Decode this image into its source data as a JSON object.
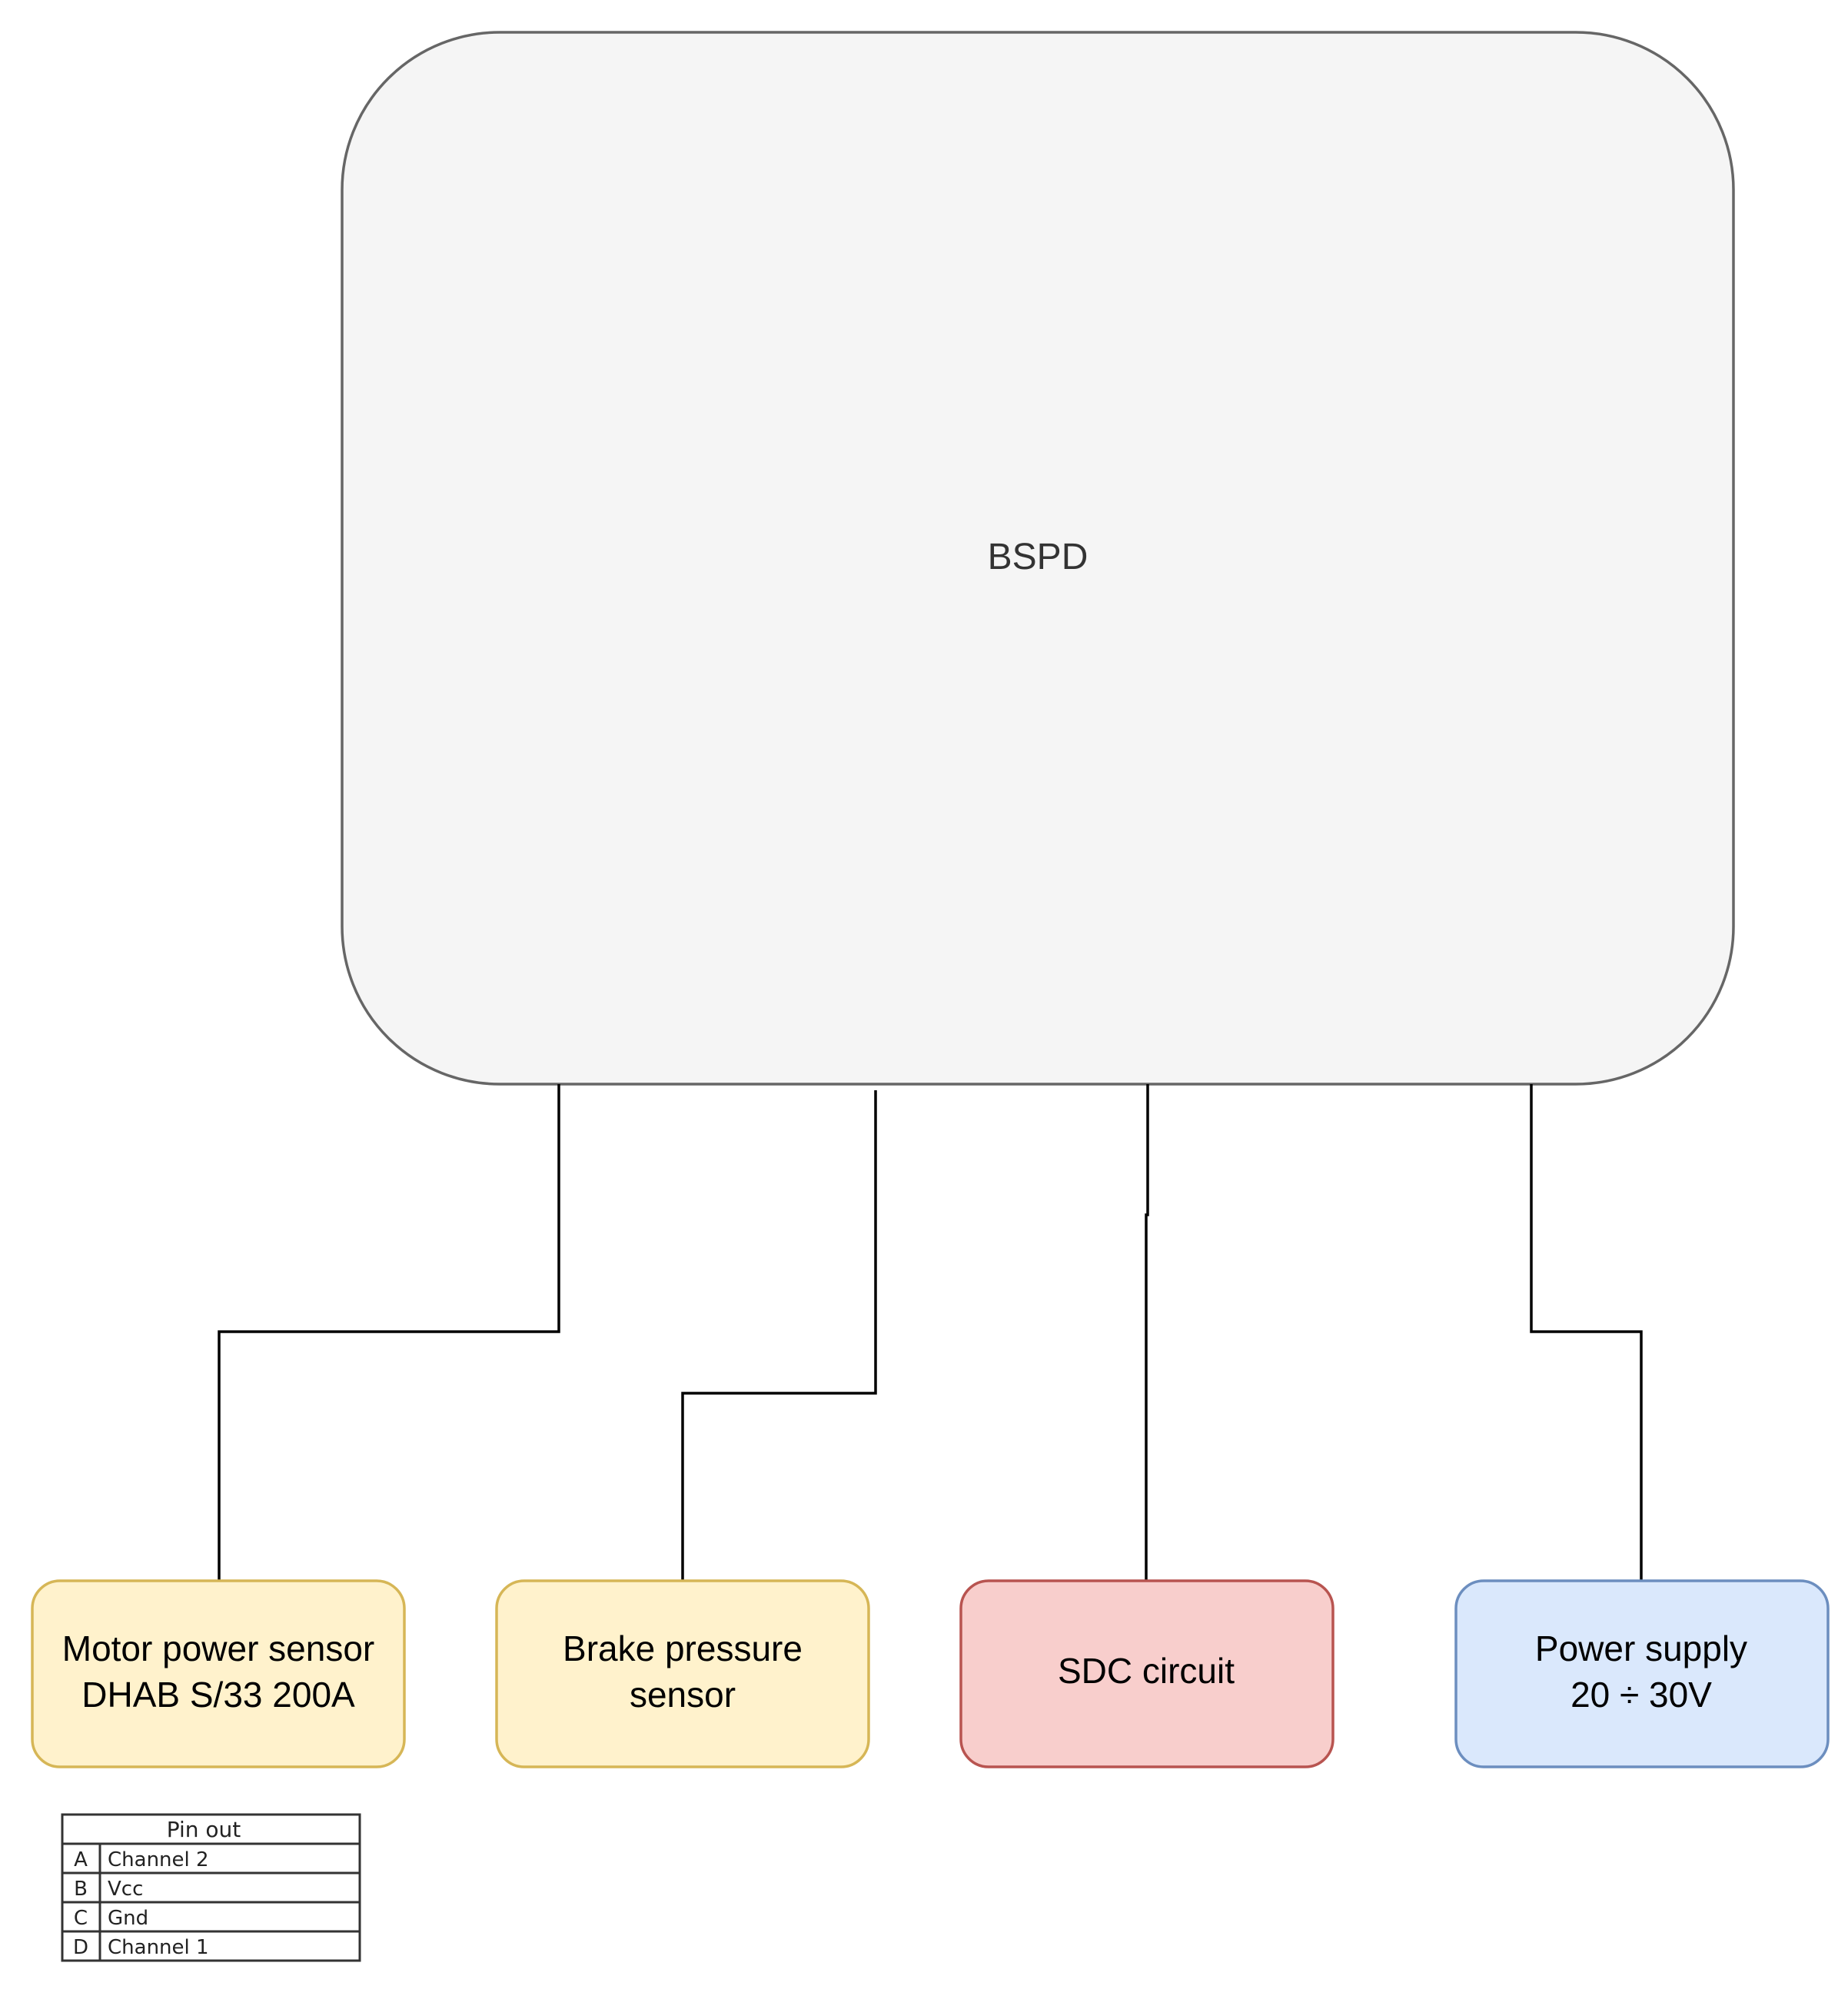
{
  "bspd": {
    "label": "BSPD",
    "fill": "#f5f5f5",
    "stroke": "#666666"
  },
  "nodes": {
    "motor_sensor": {
      "line1": "Motor power sensor",
      "line2": "DHAB S/33 200A",
      "fill": "#fff2cc",
      "stroke": "#d6b656"
    },
    "brake_sensor": {
      "line1": "Brake pressure",
      "line2": "sensor",
      "fill": "#fff2cc",
      "stroke": "#d6b656"
    },
    "sdc": {
      "line1": "SDC circuit",
      "fill": "#f8cecc",
      "stroke": "#b85450"
    },
    "power_supply": {
      "line1": "Power supply",
      "line2": "20 ÷ 30V",
      "fill": "#dae8fc",
      "stroke": "#6c8ebf"
    }
  },
  "pinout": {
    "title": "Pin out",
    "rows": [
      {
        "pin": "A",
        "signal": "Channel 2"
      },
      {
        "pin": "B",
        "signal": "Vcc"
      },
      {
        "pin": "C",
        "signal": "Gnd"
      },
      {
        "pin": "D",
        "signal": "Channel 1"
      }
    ]
  }
}
